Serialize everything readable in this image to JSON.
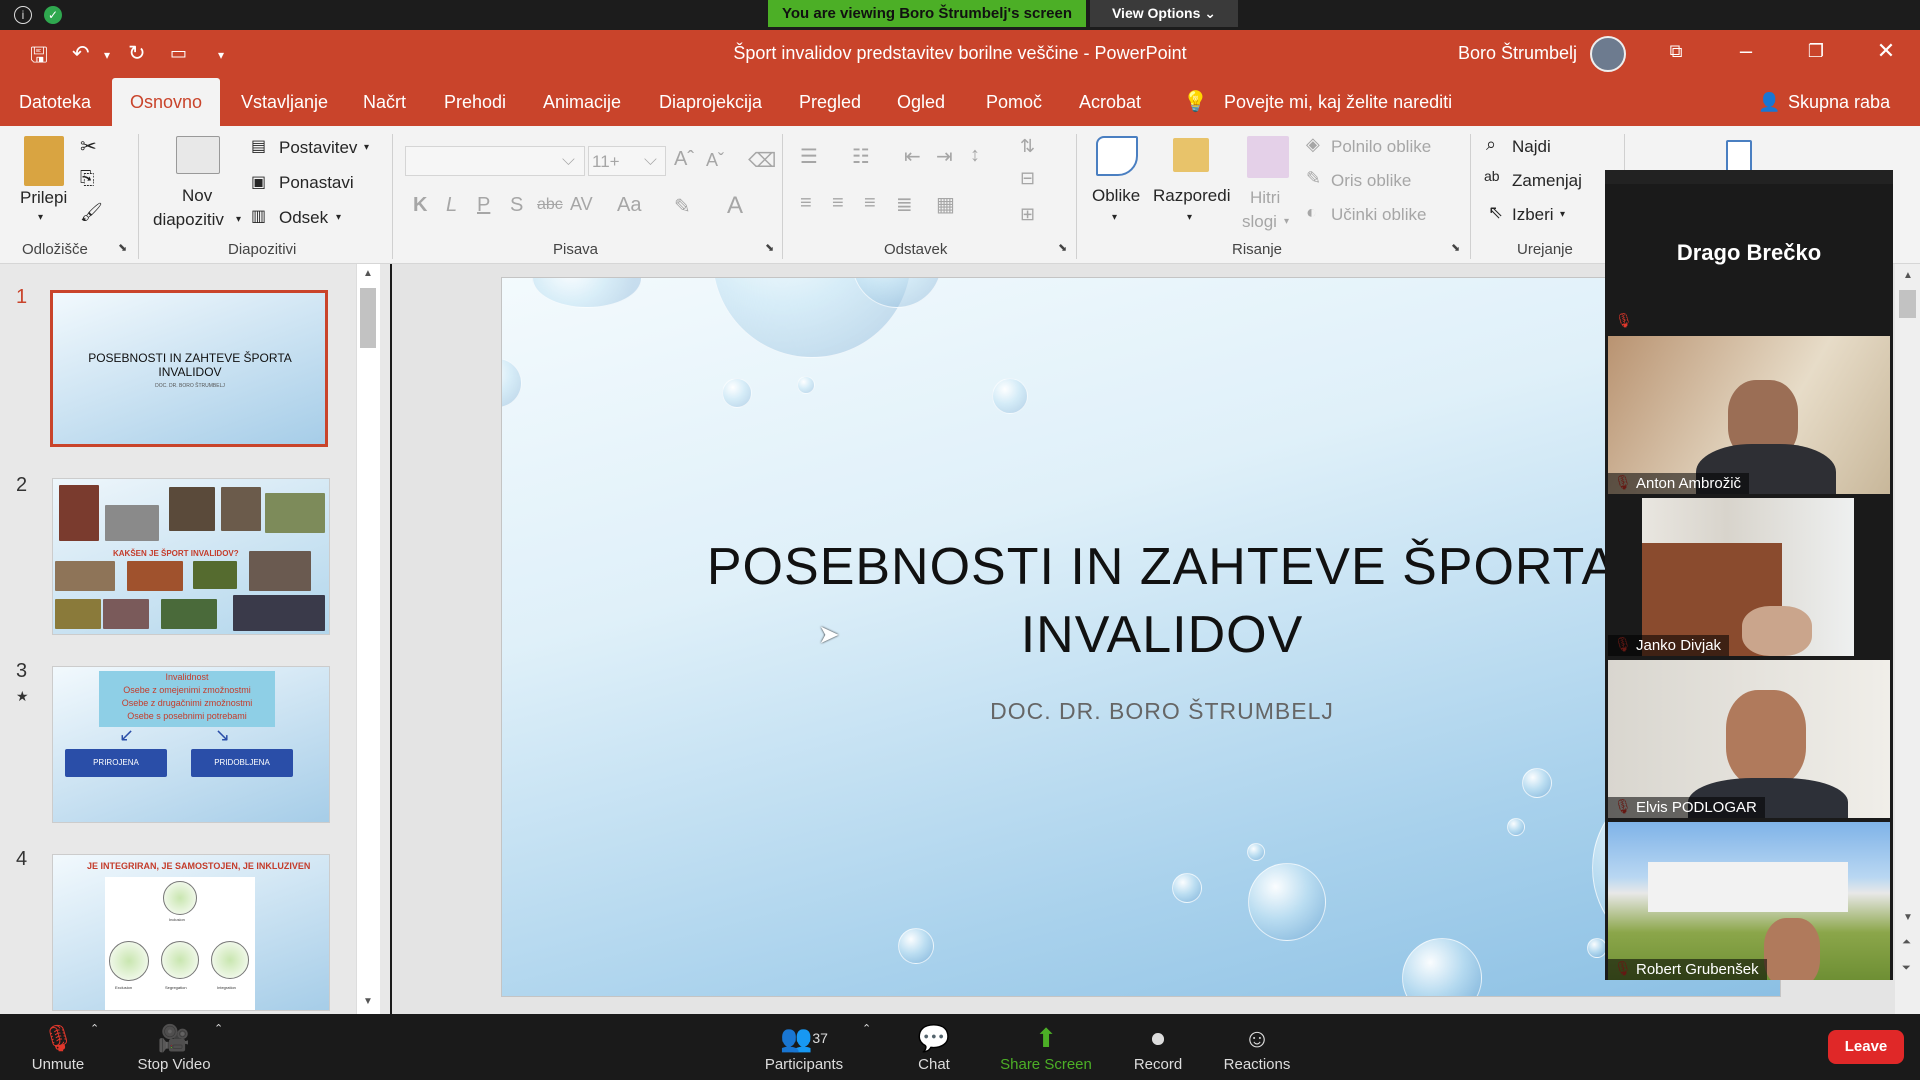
{
  "zoom_top": {
    "viewing_banner": "You are viewing Boro Štrumbelj's screen",
    "view_options": "View Options ⌄",
    "colors": {
      "banner": "#4caf26"
    }
  },
  "titlebar": {
    "doc_title": "Šport invalidov predstavitev borilne veščine  -  PowerPoint",
    "user": "Boro Štrumbelj"
  },
  "tabs": [
    "Datoteka",
    "Osnovno",
    "Vstavljanje",
    "Načrt",
    "Prehodi",
    "Animacije",
    "Diaprojekcija",
    "Pregled",
    "Ogled",
    "Pomoč",
    "Acrobat"
  ],
  "tell_me": "Povejte mi, kaj želite narediti",
  "share": "Skupna raba",
  "ribbon": {
    "paste": "Prilepi",
    "clipboard_group": "Odložišče",
    "new_slide_1": "Nov",
    "new_slide_2": "diapozitiv",
    "layout": "Postavitev",
    "reset": "Ponastavi",
    "section": "Odsek",
    "slides_group": "Diapozitivi",
    "font_size": "11+",
    "font_group": "Pisava",
    "bold": "K",
    "italic": "L",
    "underline": "P",
    "shadow": "S",
    "strike": "abc",
    "spacing": "AV",
    "case": "Aa",
    "paragraph_group": "Odstavek",
    "shapes": "Oblike",
    "arrange": "Razporedi",
    "quick_1": "Hitri",
    "quick_2": "slogi",
    "fill": "Polnilo oblike",
    "outline": "Oris oblike",
    "effects": "Učinki oblike",
    "drawing_group": "Risanje",
    "find": "Najdi",
    "replace": "Zamenjaj",
    "select": "Izberi",
    "editing_group": "Urejanje"
  },
  "slides": [
    {
      "num": "1",
      "title": "POSEBNOSTI IN ZAHTEVE ŠPORTA INVALIDOV",
      "subtitle": "DOC. DR. BORO ŠTRUMBELJ"
    },
    {
      "num": "2",
      "heading": "KAKŠEN JE ŠPORT INVALIDOV?"
    },
    {
      "num": "3",
      "box": [
        "Invalidnost",
        "Osebe z omejenimi zmožnostmi",
        "Osebe z drugačnimi zmožnostmi",
        "Osebe s posebnimi potrebami"
      ],
      "btn_left": "PRIROJENA",
      "btn_right": "PRIDOBLJENA"
    },
    {
      "num": "4",
      "heading": "JE INTEGRIRAN, JE SAMOSTOJEN, JE INKLUZIVEN",
      "labels": [
        "Exclusion",
        "Segregation",
        "Integration"
      ],
      "top_label": "Inclusion"
    }
  ],
  "main_slide": {
    "title_line1": "POSEBNOSTI IN ZAHTEVE ŠPORTA",
    "title_line2": "INVALIDOV",
    "subtitle": "DOC. DR. BORO ŠTRUMBELJ"
  },
  "gallery": {
    "speaker": "Drago Brečko",
    "participants": [
      "Anton Ambrožič",
      "Janko Divjak",
      "Elvis PODLOGAR",
      "Robert Grubenšek"
    ]
  },
  "zoom_bar": {
    "unmute": "Unmute",
    "stop_video": "Stop Video",
    "participants": "Participants",
    "participant_count": "37",
    "chat": "Chat",
    "share": "Share Screen",
    "record": "Record",
    "reactions": "Reactions",
    "leave": "Leave"
  }
}
